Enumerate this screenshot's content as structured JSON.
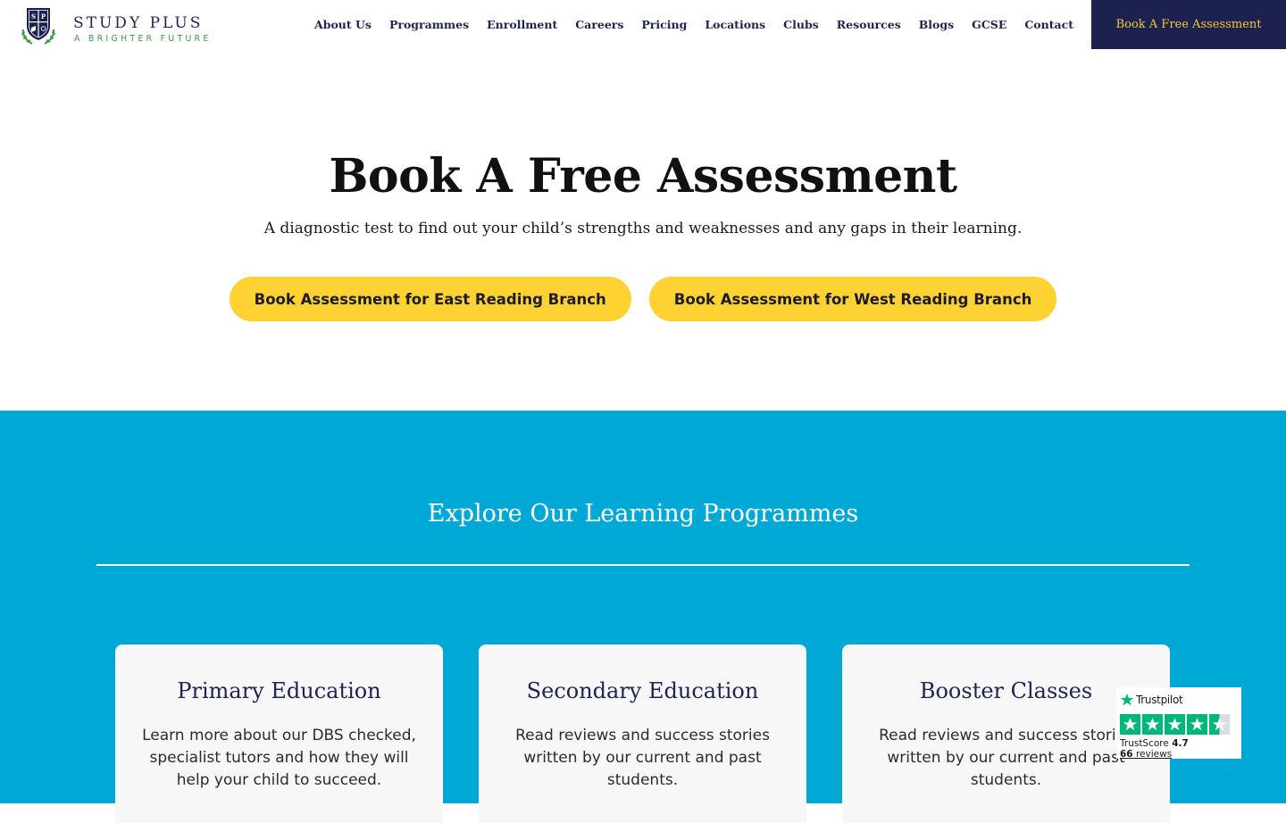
{
  "header": {
    "brand_name": "STUDY PLUS",
    "brand_tagline": "A BRIGHTER FUTURE",
    "logo_crest_icon": "shield-crest-icon",
    "nav_items": [
      {
        "label": "About Us"
      },
      {
        "label": "Programmes"
      },
      {
        "label": "Enrollment"
      },
      {
        "label": "Careers"
      },
      {
        "label": "Pricing"
      },
      {
        "label": "Locations"
      },
      {
        "label": "Clubs"
      },
      {
        "label": "Resources"
      },
      {
        "label": "Blogs"
      },
      {
        "label": "GCSE"
      },
      {
        "label": "Contact"
      }
    ],
    "cta_label": "Book A Free Assessment"
  },
  "hero": {
    "title": "Book A Free Assessment",
    "subtitle": "A diagnostic test to find out your child’s strengths and weaknesses and any gaps in their learning.",
    "buttons": [
      {
        "label": "Book Assessment for East Reading Branch"
      },
      {
        "label": "Book Assessment for West Reading Branch"
      }
    ]
  },
  "programmes": {
    "title": "Explore Our Learning Programmes",
    "cards": [
      {
        "title": "Primary Education",
        "text": "Learn more about our DBS checked, specialist tutors and how they will help your child to succeed."
      },
      {
        "title": "Secondary Education",
        "text": "Read reviews and success stories written by our current and past students."
      },
      {
        "title": "Booster Classes",
        "text": "Read reviews and success stories written by our current and past students."
      }
    ]
  },
  "trustpilot": {
    "brand": "Trustpilot",
    "score_label": "TrustScore",
    "score": "4.7",
    "reviews_count": "66",
    "reviews_label": "reviews",
    "star_rating": 4.5,
    "star_icon": "star-icon"
  },
  "colors": {
    "navy": "#1c2150",
    "yellow": "#ffd234",
    "accent_gold": "#f5c936",
    "programmes_bg": "#00a8d6",
    "trustpilot_green": "#00b67a",
    "tagline_green": "#3f9a45"
  }
}
